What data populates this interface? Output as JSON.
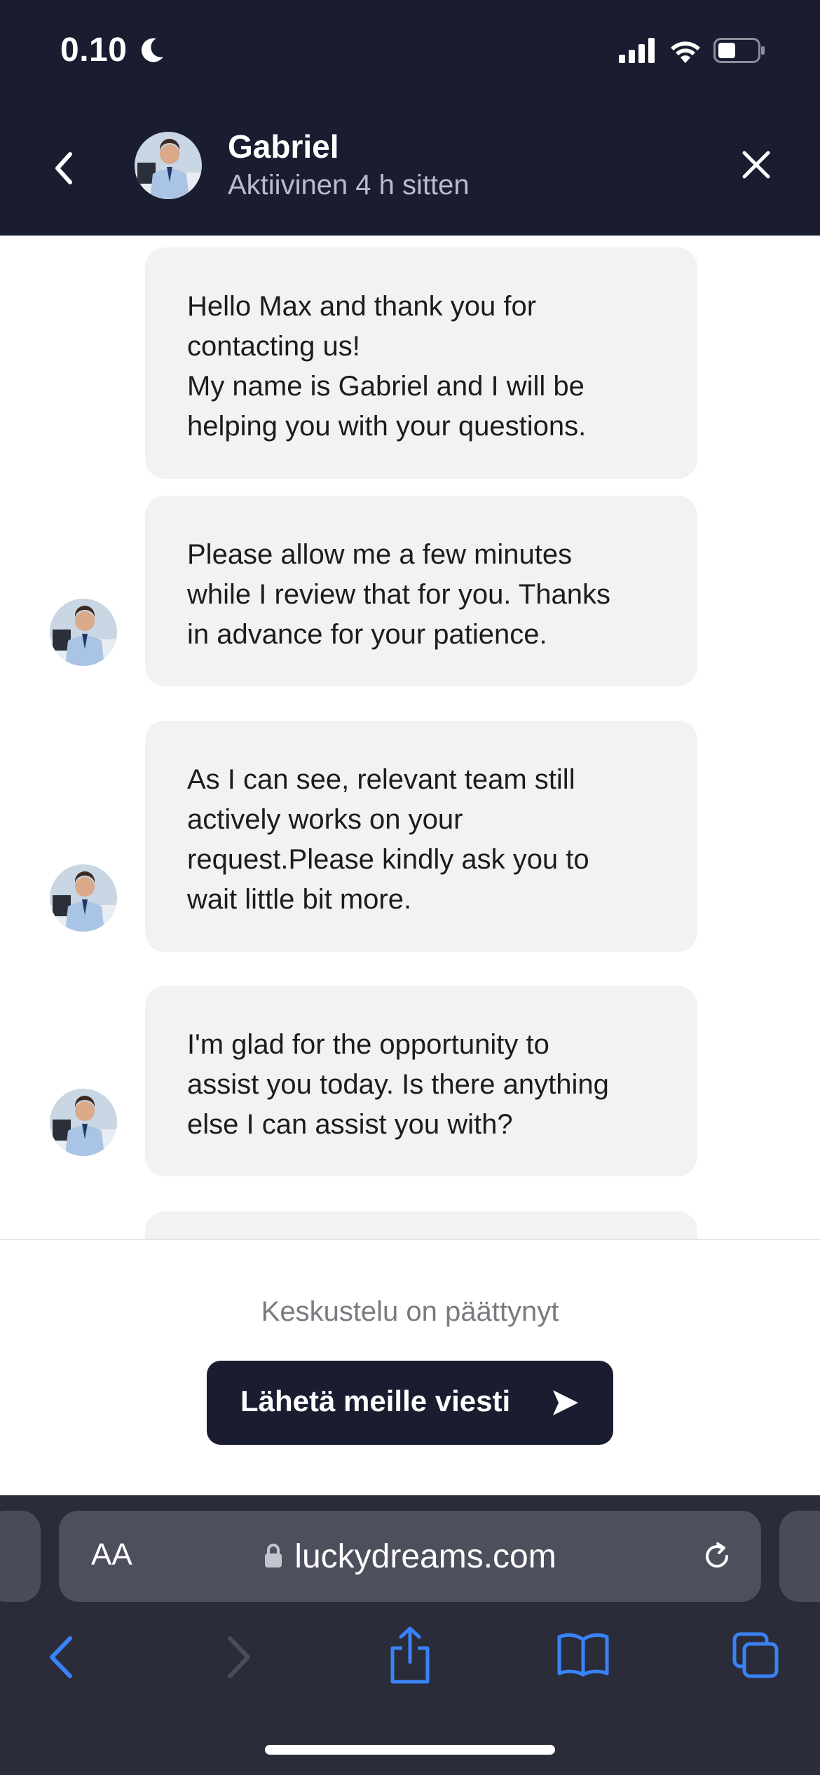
{
  "status_bar": {
    "time": "0.10",
    "icons": [
      "moon-icon",
      "signal-icon",
      "wifi-icon",
      "battery-icon"
    ]
  },
  "header": {
    "agent_name": "Gabriel",
    "agent_status": "Aktiivinen 4 h sitten",
    "icons": [
      "chevron-left-icon",
      "avatar",
      "close-icon"
    ]
  },
  "messages": [
    {
      "text": "Hello Max and thank you for\ncontacting us!\nMy name is Gabriel and I will be\nhelping you with your questions.",
      "has_avatar": false
    },
    {
      "text": "Please allow me a few minutes\nwhile I review that for you. Thanks\nin advance for your patience.",
      "has_avatar": true
    },
    {
      "text": "As I can see, relevant team still\nactively works on your\nrequest.Please kindly ask you to\nwait little bit more.",
      "has_avatar": true
    },
    {
      "text": "I'm glad for the opportunity to\nassist you today. Is there anything\nelse I can assist you with?",
      "has_avatar": true
    }
  ],
  "footer": {
    "ended_text": "Keskustelu on päättynyt",
    "send_button_label": "Lähetä meille viesti"
  },
  "browser": {
    "text_size_button": "AA",
    "url": "luckydreams.com",
    "toolbar": [
      "back-icon",
      "forward-icon",
      "share-icon",
      "bookmarks-icon",
      "tabs-icon"
    ]
  },
  "colors": {
    "header_bg": "#1a1d30",
    "bubble_bg": "#f2f2f2",
    "browser_bg": "#2a2c3a",
    "safari_blue": "#3a82f7"
  }
}
